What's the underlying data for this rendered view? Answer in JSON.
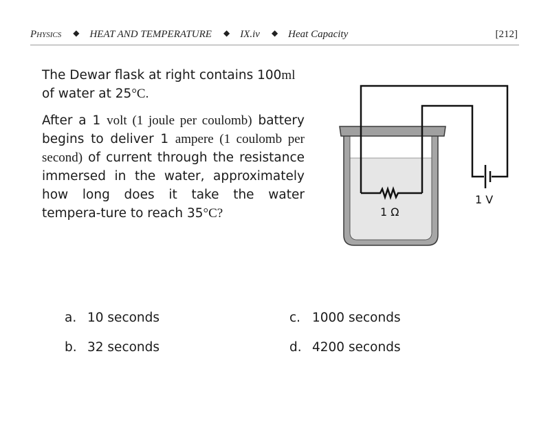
{
  "header": {
    "subject": "Physics",
    "chapter": "HEAT AND TEMPERATURE",
    "section": "IX.iv",
    "topic": "Heat Capacity",
    "page_number": "[212]",
    "separator": "◆"
  },
  "question": {
    "paragraph1": {
      "part1": "The Dewar flask at right contains 100",
      "unit": "ml",
      "part2": "of water at 25",
      "temp_unit": "°C."
    },
    "paragraph2": {
      "part1": "After a  1 ",
      "serif1": "volt (1 joule per coulomb)",
      "part2": " battery begins to deliver 1 ",
      "serif2": "ampere (1 coulomb per second)",
      "part3": " of current through the resistance immersed in the water, approximately how long does it take the water tempera-ture to reach 35",
      "temp_unit": "°C?"
    }
  },
  "diagram": {
    "resistor_label": "1 Ω",
    "battery_label": "1 V",
    "colors": {
      "flask_wall": "#a6a6a6",
      "flask_outline": "#3a3a3a",
      "water": "#e6e6e6",
      "wire": "#111111"
    }
  },
  "answers": [
    {
      "letter": "a.",
      "text": "10 seconds"
    },
    {
      "letter": "b.",
      "text": "32 seconds"
    },
    {
      "letter": "c.",
      "text": "1000 seconds"
    },
    {
      "letter": "d.",
      "text": "4200 seconds"
    }
  ]
}
